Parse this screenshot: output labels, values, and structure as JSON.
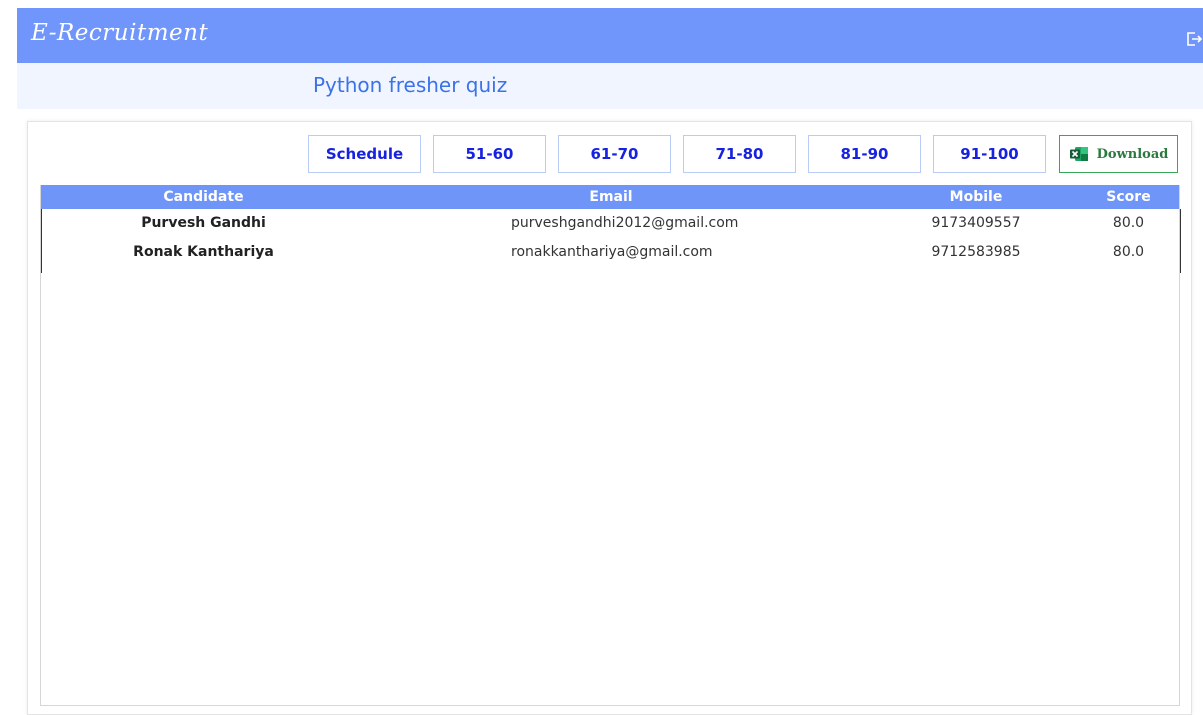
{
  "app": {
    "title": "E-Recruitment"
  },
  "quiz": {
    "title": "Python fresher quiz"
  },
  "filters": [
    {
      "label": "Schedule"
    },
    {
      "label": "51-60"
    },
    {
      "label": "61-70"
    },
    {
      "label": "71-80"
    },
    {
      "label": "81-90"
    },
    {
      "label": "91-100"
    }
  ],
  "download": {
    "label": "Download",
    "icon": "excel-icon",
    "color": "#3aa65a"
  },
  "table": {
    "headers": {
      "candidate": "Candidate",
      "email": "Email",
      "mobile": "Mobile",
      "score": "Score"
    },
    "rows": [
      {
        "candidate": "Purvesh  Gandhi",
        "email": "purveshgandhi2012@gmail.com",
        "mobile": "9173409557",
        "score": "80.0"
      },
      {
        "candidate": "Ronak  Kanthariya",
        "email": "ronakkanthariya@gmail.com",
        "mobile": "9712583985",
        "score": "80.0"
      }
    ]
  },
  "colors": {
    "header": "#7096fb",
    "subheader": "#f0f5ff",
    "accent_text": "#1722e0"
  },
  "icons": {
    "logout": "logout-icon"
  }
}
